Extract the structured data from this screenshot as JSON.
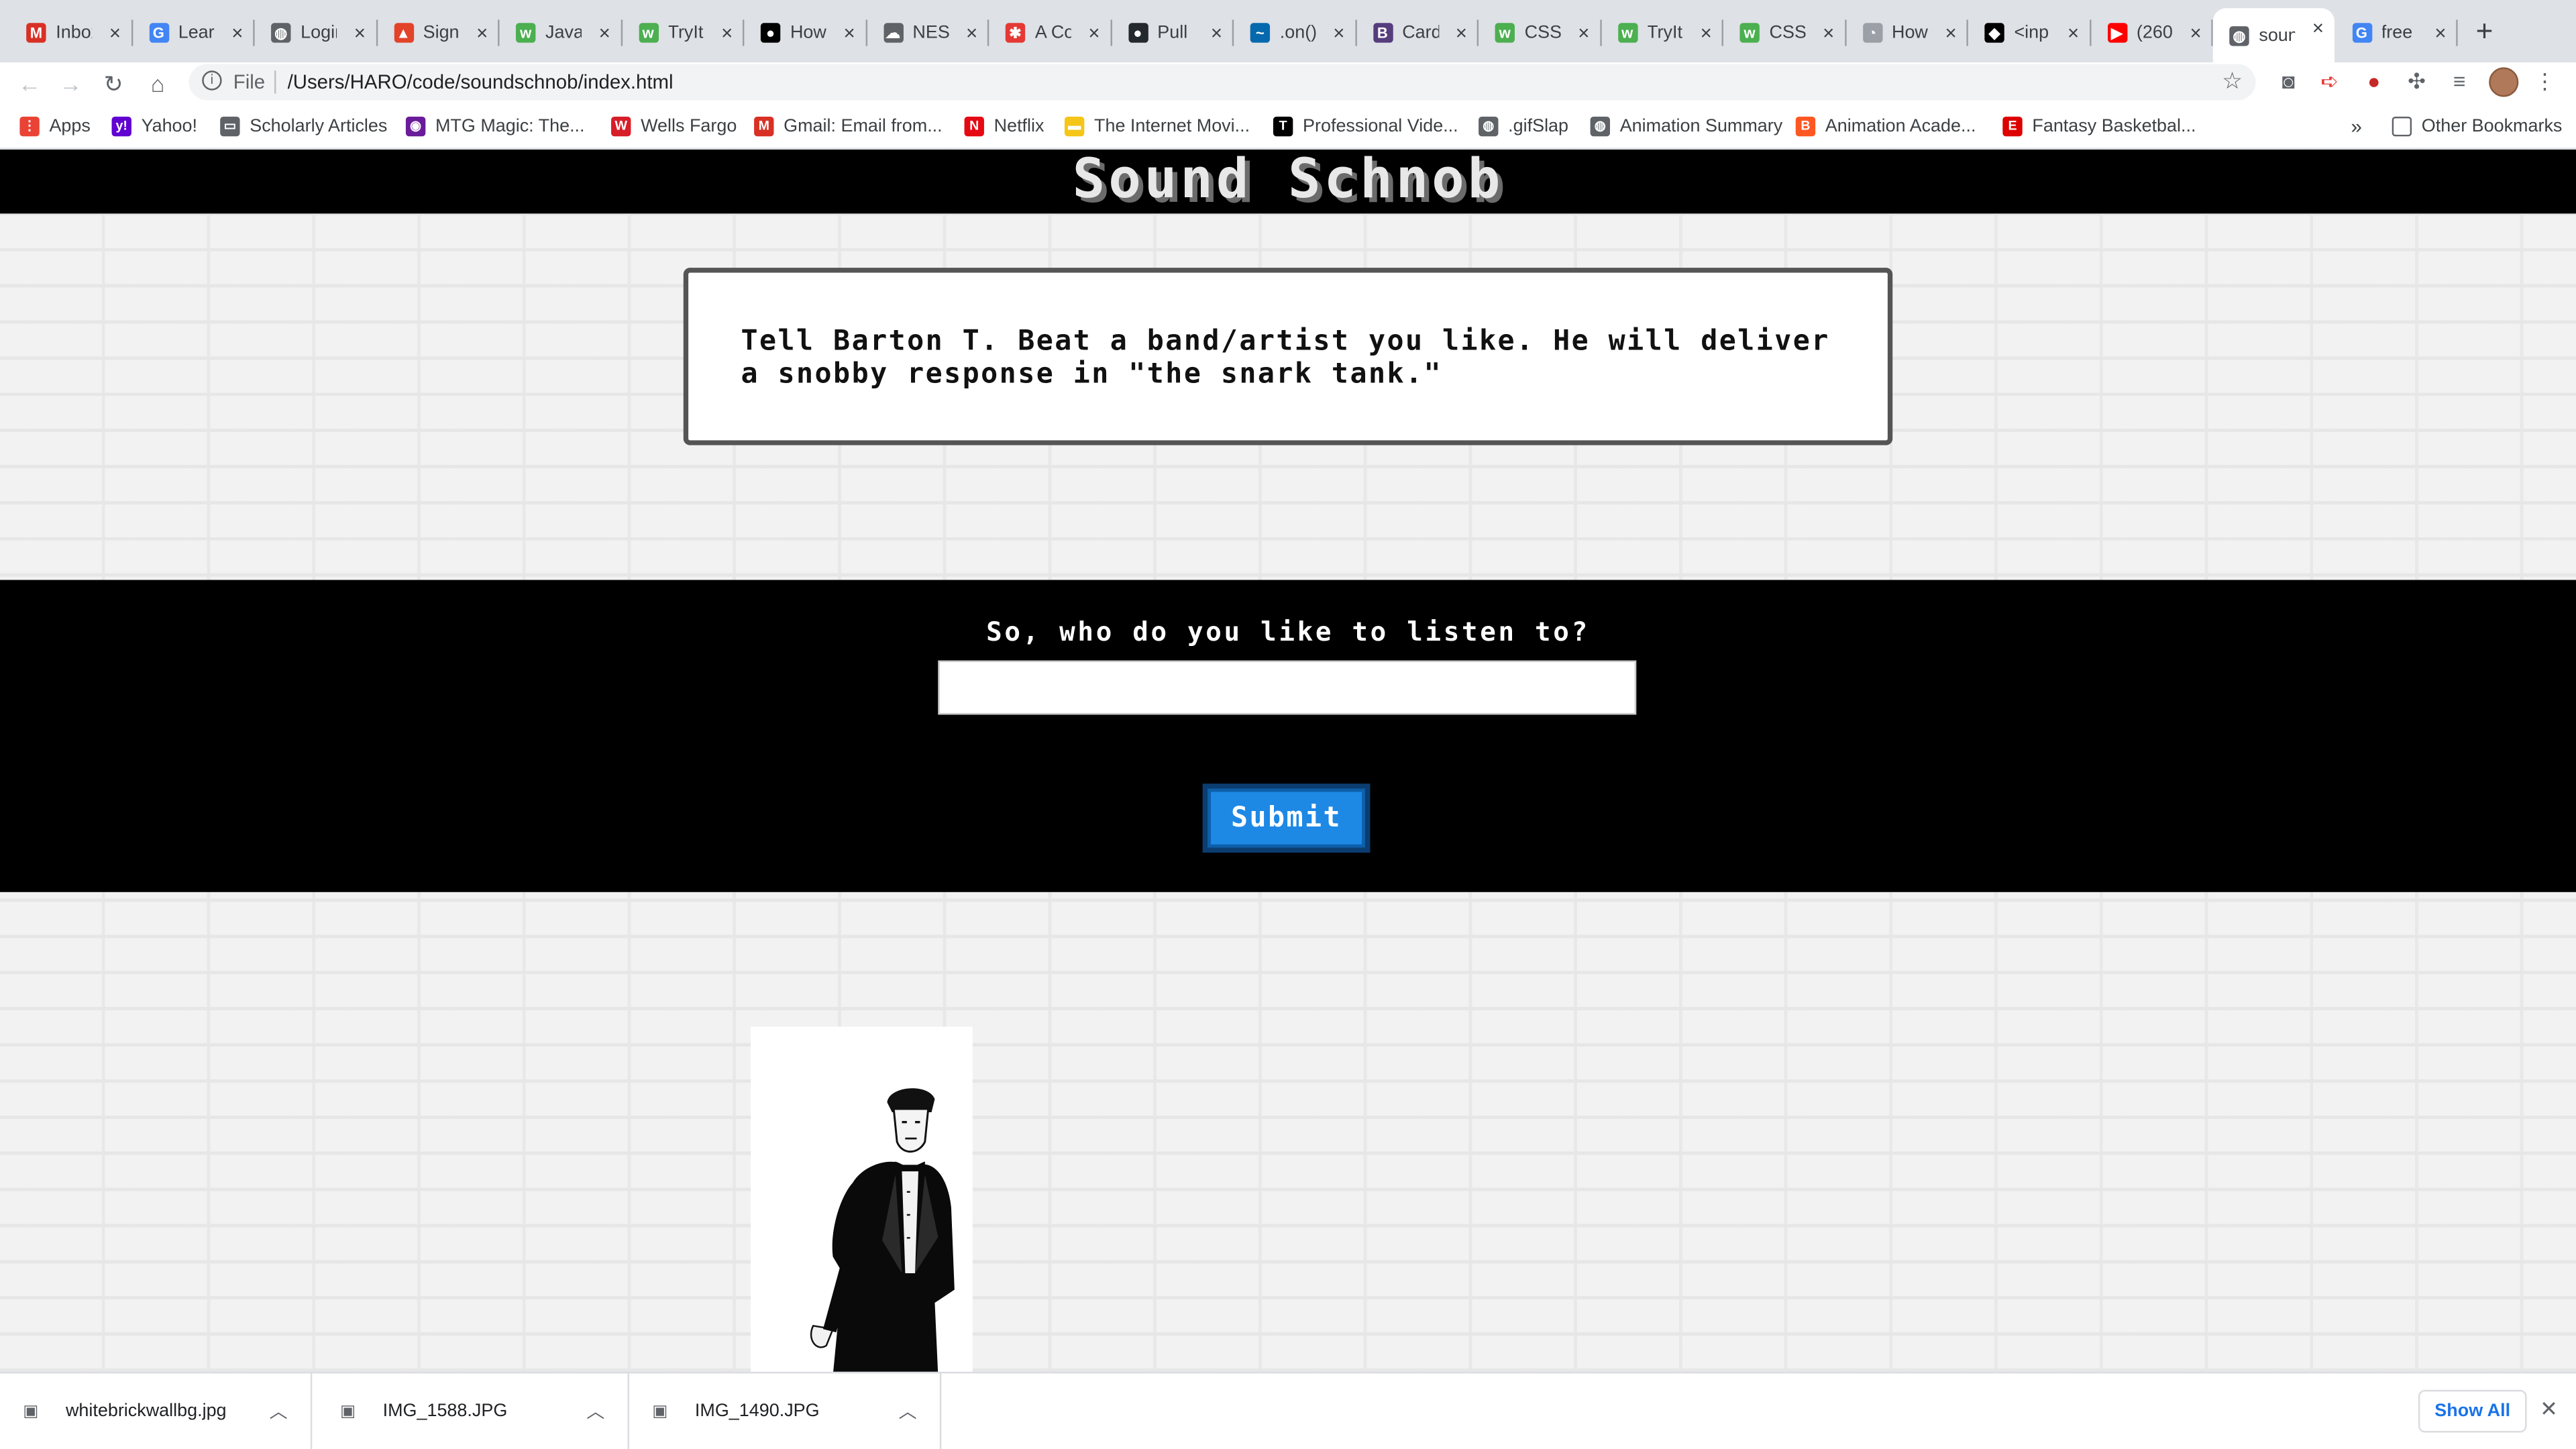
{
  "browser": {
    "tabs": [
      {
        "label": "Inbox",
        "favicon": "gmail-icon",
        "color": "#d93025",
        "glyph": "M"
      },
      {
        "label": "Learn",
        "favicon": "google-icon",
        "color": "#4285f4",
        "glyph": "G"
      },
      {
        "label": "Login",
        "favicon": "globe-icon",
        "color": "#5f6368",
        "glyph": "◍"
      },
      {
        "label": "Sign",
        "favicon": "gitlab-icon",
        "color": "#e24329",
        "glyph": "▲"
      },
      {
        "label": "Java",
        "favicon": "w3schools-icon",
        "color": "#4caf50",
        "glyph": "w"
      },
      {
        "label": "TryIt",
        "favicon": "w3schools-icon",
        "color": "#4caf50",
        "glyph": "w"
      },
      {
        "label": "How",
        "favicon": "medium-icon",
        "color": "#000000",
        "glyph": "●"
      },
      {
        "label": "NES",
        "favicon": "cloud-icon",
        "color": "#5f6368",
        "glyph": "☁"
      },
      {
        "label": "A Co",
        "favicon": "circle-icon",
        "color": "#e53935",
        "glyph": "✱"
      },
      {
        "label": "Pull",
        "favicon": "github-icon",
        "color": "#24292e",
        "glyph": "●"
      },
      {
        "label": ".on()",
        "favicon": "jquery-icon",
        "color": "#0769ad",
        "glyph": "~"
      },
      {
        "label": "Card",
        "favicon": "bootstrap-icon",
        "color": "#563d7c",
        "glyph": "B"
      },
      {
        "label": "CSS",
        "favicon": "w3schools-icon",
        "color": "#4caf50",
        "glyph": "w"
      },
      {
        "label": "TryIt",
        "favicon": "w3schools-icon",
        "color": "#4caf50",
        "glyph": "w"
      },
      {
        "label": "CSS",
        "favicon": "w3schools-icon",
        "color": "#4caf50",
        "glyph": "w"
      },
      {
        "label": "How",
        "favicon": "devdocs-icon",
        "color": "#9aa0a6",
        "glyph": "◔"
      },
      {
        "label": "<inp",
        "favicon": "mdn-icon",
        "color": "#000000",
        "glyph": "◆"
      },
      {
        "label": "(260",
        "favicon": "youtube-icon",
        "color": "#ff0000",
        "glyph": "▶"
      },
      {
        "label": "soun",
        "favicon": "globe-icon",
        "color": "#5f6368",
        "glyph": "◍",
        "active": true
      },
      {
        "label": "free",
        "favicon": "google-icon",
        "color": "#4285f4",
        "glyph": "G"
      }
    ],
    "url_scheme": "File",
    "url": "/Users/HARO/code/soundschnob/index.html",
    "bookmarks": [
      {
        "label": "Apps",
        "icon": "apps-grid-icon",
        "color": "#ea4335",
        "glyph": "⋮"
      },
      {
        "label": "Yahoo!",
        "icon": "yahoo-icon",
        "color": "#6001d2",
        "glyph": "y!"
      },
      {
        "label": "Scholarly Articles",
        "icon": "folder-icon",
        "color": "#5f6368",
        "glyph": "▭"
      },
      {
        "label": "MTG Magic: The...",
        "icon": "mtg-icon",
        "color": "#6a1b9a",
        "glyph": "◉"
      },
      {
        "label": "Wells Fargo",
        "icon": "wellsfargo-icon",
        "color": "#d71e28",
        "glyph": "W"
      },
      {
        "label": "Gmail: Email from...",
        "icon": "gmail-icon",
        "color": "#d93025",
        "glyph": "M"
      },
      {
        "label": "Netflix",
        "icon": "netflix-icon",
        "color": "#e50914",
        "glyph": "N"
      },
      {
        "label": "The Internet Movi...",
        "icon": "imdb-icon",
        "color": "#f5c518",
        "glyph": "▬"
      },
      {
        "label": "Professional Vide...",
        "icon": "nytimes-icon",
        "color": "#000000",
        "glyph": "T"
      },
      {
        "label": ".gifSlap",
        "icon": "globe-icon",
        "color": "#5f6368",
        "glyph": "◍"
      },
      {
        "label": "Animation Summary",
        "icon": "globe-icon",
        "color": "#5f6368",
        "glyph": "◍"
      },
      {
        "label": "Animation Acade...",
        "icon": "blogger-icon",
        "color": "#ff5722",
        "glyph": "B"
      },
      {
        "label": "Fantasy Basketbal...",
        "icon": "espn-icon",
        "color": "#d00",
        "glyph": "E"
      }
    ],
    "bookmarks_overflow": "»",
    "other_bookmarks": "Other Bookmarks"
  },
  "page": {
    "title": "Sound Schnob",
    "intro": "Tell Barton T. Beat a band/artist you like. He will deliver a snobby response in \"the snark tank.\"",
    "prompt": "So, who do you like to listen to?",
    "input_value": "",
    "input_placeholder": "",
    "submit_label": "Submit"
  },
  "downloads": {
    "items": [
      {
        "name": "whitebrickwallbg.jpg"
      },
      {
        "name": "IMG_1588.JPG"
      },
      {
        "name": "IMG_1490.JPG"
      }
    ],
    "show_all": "Show All"
  }
}
